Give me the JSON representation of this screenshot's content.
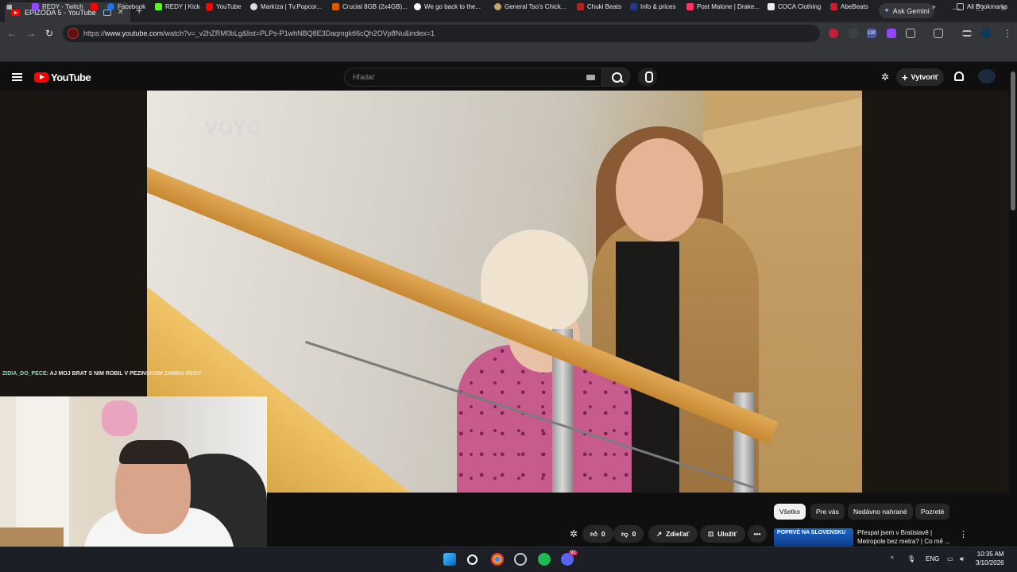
{
  "browser": {
    "tab_title": "EPIZÓDA 5 - YouTube",
    "tab_close": "✕",
    "new_tab": "+",
    "gemini_label": "Ask Gemini",
    "window_controls": [
      "—",
      "❐",
      "✕"
    ],
    "url_prefix": "https://",
    "url_host": "www.youtube.com",
    "url_path": "/watch?v=_v2hZRM0bLg&list=PLPs-P1whNBQ8E3DaqmgktI6cQh2OVp8Nu&index=1",
    "extension_badge": "130",
    "bookmarks": [
      {
        "label": "REDY - Twitch",
        "color": "#9146ff"
      },
      {
        "label": "",
        "color": "#ff0000"
      },
      {
        "label": "Facebook",
        "color": "#1877f2"
      },
      {
        "label": "REDY | Kick",
        "color": "#53fc18"
      },
      {
        "label": "YouTube",
        "color": "#ff0000"
      },
      {
        "label": "Markíza | Tv.Popcor...",
        "color": "#dddddd"
      },
      {
        "label": "Crucial 8GB (2x4GB)...",
        "color": "#e05a00"
      },
      {
        "label": "We go back to the...",
        "color": "#ffffff"
      },
      {
        "label": "General Tso's Chick...",
        "color": "#c9a56c"
      },
      {
        "label": "Chuki Beats",
        "color": "#b22222"
      },
      {
        "label": "Info & prices",
        "color": "#1e3a8a"
      },
      {
        "label": "Post Malone | Drake...",
        "color": "#ff3366"
      },
      {
        "label": "COCA Clothing",
        "color": "#eeeeee"
      },
      {
        "label": "AbeBeats",
        "color": "#d11a2a"
      }
    ],
    "bookmarks_more": "»",
    "all_bookmarks": "All Bookmarks"
  },
  "youtube": {
    "logo_text": "YouTube",
    "search_placeholder": "Hľadať",
    "create_label": "Vytvoriť",
    "create_plus": "+"
  },
  "video": {
    "watermark": "VOYO"
  },
  "chat": {
    "username": "ZIDIA_DO_PECE",
    "message": ": AJ MOJ BRAT S NIM ROBIL V PEZINSKOM ZAMKU REDY"
  },
  "actions": {
    "like_count": "0",
    "dislike_count": "0",
    "share_label": "Zdieľať",
    "save_label": "Uložiť",
    "more": "•••"
  },
  "chips": [
    "Všetko",
    "Pre vás",
    "Nedávno nahrané",
    "Pozreté"
  ],
  "recommendation": {
    "thumb_text": "POPRVÉ NA SLOVENSKU",
    "title": "Přespal jsem v Bratislavě | Metropole bez metra? | Co mě ...",
    "menu": "⋮"
  },
  "taskbar": {
    "tray_up": "^",
    "language": "ENG",
    "time": "10:35 AM",
    "date": "3/10/2026",
    "discord_badge": "91"
  },
  "colors": {
    "youtube_red": "#ff0000",
    "chat_username": "#7ee0c4",
    "chip_active_bg": "#f1f1f1"
  }
}
